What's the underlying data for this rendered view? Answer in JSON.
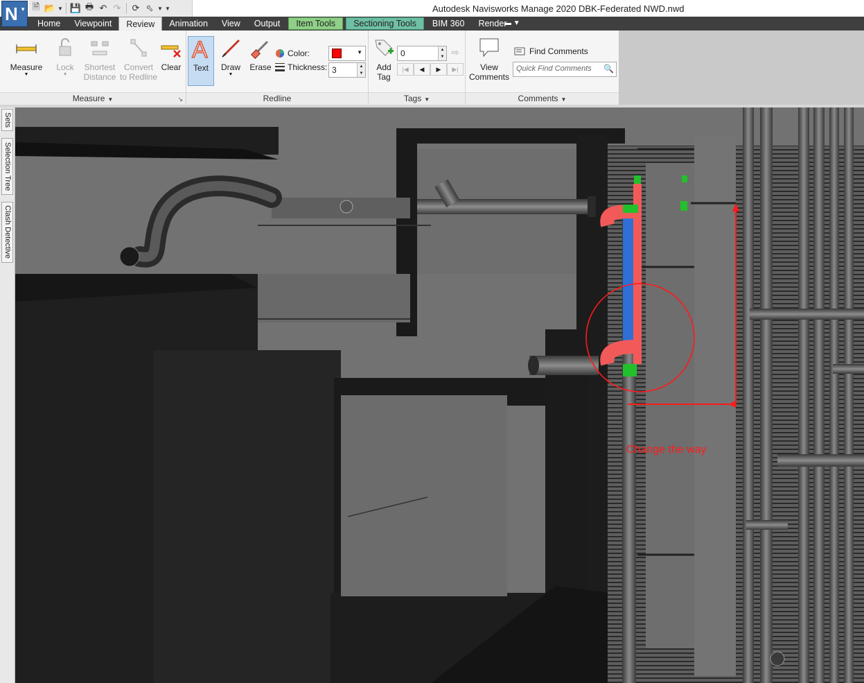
{
  "window": {
    "title": "Autodesk Navisworks Manage 2020    DBK-Federated NWD.nwd"
  },
  "app_logo": {
    "letter": "N"
  },
  "tabs": [
    {
      "label": "Home",
      "state": "normal"
    },
    {
      "label": "Viewpoint",
      "state": "normal"
    },
    {
      "label": "Review",
      "state": "active"
    },
    {
      "label": "Animation",
      "state": "normal"
    },
    {
      "label": "View",
      "state": "normal"
    },
    {
      "label": "Output",
      "state": "normal"
    },
    {
      "label": "Item Tools",
      "state": "contextual-item"
    },
    {
      "label": "Sectioning Tools",
      "state": "contextual-section"
    },
    {
      "label": "BIM 360",
      "state": "normal"
    },
    {
      "label": "Render",
      "state": "normal"
    }
  ],
  "ribbon": {
    "measure_panel": {
      "title": "Measure",
      "measure": "Measure",
      "lock": "Lock",
      "shortest_distance": "Shortest Distance",
      "shortest_line1": "Shortest",
      "shortest_line2": "Distance",
      "convert_line1": "Convert",
      "convert_line2": "to Redline",
      "clear": "Clear"
    },
    "redline_panel": {
      "title": "Redline",
      "text": "Text",
      "draw": "Draw",
      "erase": "Erase",
      "color_label": "Color:",
      "thickness_label": "Thickness:",
      "thickness_value": "3",
      "color_value": "#ff0000"
    },
    "tags_panel": {
      "title": "Tags",
      "add_tag_line1": "Add",
      "add_tag_line2": "Tag",
      "tag_id_value": "0"
    },
    "comments_panel": {
      "title": "Comments",
      "view_line1": "View",
      "view_line2": "Comments",
      "find_comments": "Find Comments",
      "quick_find_placeholder": "Quick Find Comments"
    }
  },
  "dock_tabs": [
    "Sets",
    "Selection Tree",
    "Clash Detective"
  ],
  "redline_annotation": {
    "text": "Change the way",
    "color": "#ff1a1a"
  },
  "colors": {
    "tab_bar": "#3f3f3f",
    "viewport_bg": "#707070",
    "pipe_red": "#f25a5a",
    "pipe_blue": "#2f6fd6",
    "pipe_green": "#22c02a",
    "redline": "#ff1a1a"
  }
}
